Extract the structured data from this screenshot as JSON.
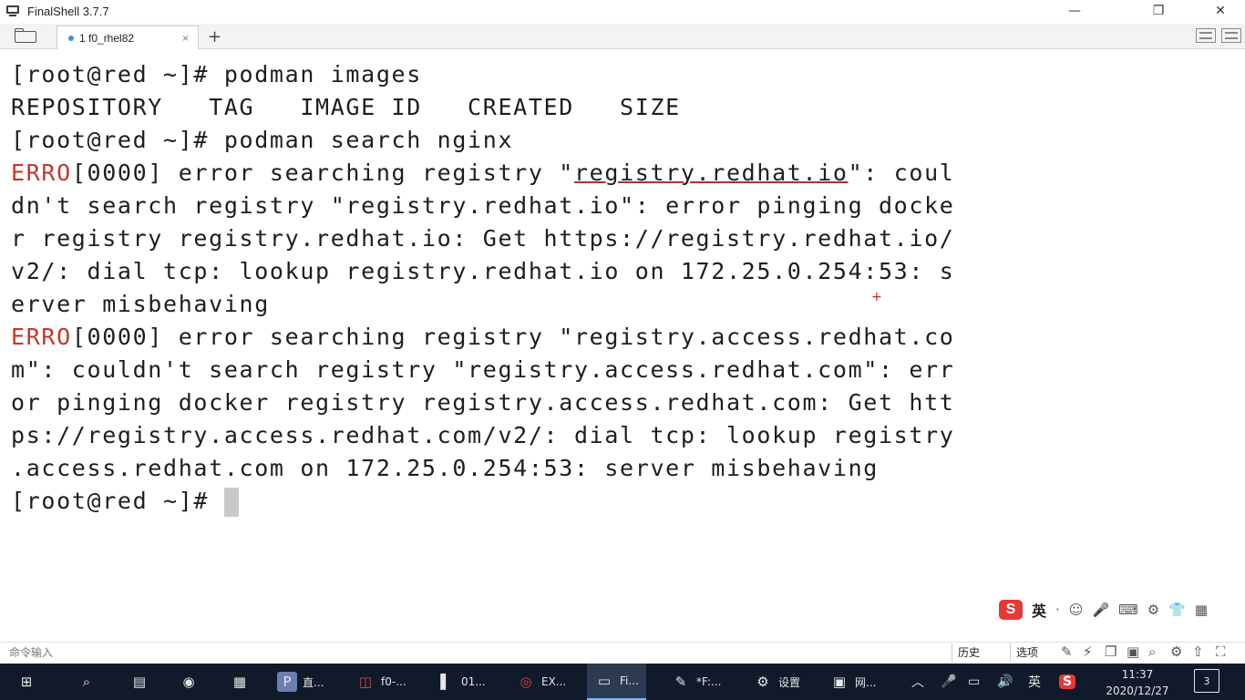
{
  "window": {
    "title": "FinalShell 3.7.7",
    "minimize": "—",
    "restore": "❐",
    "close": "✕"
  },
  "tabs": [
    {
      "label": "1 f0_rhel82",
      "close": "×"
    }
  ],
  "add_tab": "+",
  "terminal": {
    "l1": "[root@red ~]# podman images",
    "l2": "REPOSITORY   TAG   IMAGE ID   CREATED   SIZE",
    "l3": "[root@red ~]# podman search nginx",
    "erro": "ERRO",
    "l4_a": "[0000] error searching registry \"",
    "l4_u": "registry.redhat.io",
    "l4_b": "\": coul",
    "l5": "dn't search registry \"registry.redhat.io\": error pinging docke",
    "l6": "r registry registry.redhat.io: Get https://registry.redhat.io/",
    "l7": "v2/: dial tcp: lookup registry.redhat.io on 172.25.0.254:53: s",
    "l8": "erver misbehaving",
    "l9_b": "[0000] error searching registry \"registry.access.redhat.co",
    "l10": "m\": couldn't search registry \"registry.access.redhat.com\": err",
    "l11": "or pinging docker registry registry.access.redhat.com: Get htt",
    "l12": "ps://registry.access.redhat.com/v2/: dial tcp: lookup registry",
    "l13": ".access.redhat.com on 172.25.0.254:53: server misbehaving",
    "l14": "[root@red ~]# "
  },
  "ime": {
    "logo": "S",
    "lang": "英",
    "icons": [
      "·",
      "☺",
      "🎤",
      "⌨",
      "⚙",
      "👕",
      "▦"
    ]
  },
  "statusbar": {
    "input_placeholder": "命令输入",
    "history": "历史",
    "options": "选项"
  },
  "taskbar": {
    "items": [
      {
        "icon": "⊞",
        "label": ""
      },
      {
        "icon": "⌕",
        "label": ""
      },
      {
        "icon": "▤",
        "label": ""
      },
      {
        "icon": "◉",
        "label": ""
      },
      {
        "icon": "▦",
        "label": ""
      },
      {
        "icon": "P",
        "label": "直..."
      },
      {
        "icon": "◫",
        "label": "f0-..."
      },
      {
        "icon": "▌",
        "label": "01..."
      },
      {
        "icon": "◎",
        "label": "EX..."
      },
      {
        "icon": "▭",
        "label": "Fi..."
      },
      {
        "icon": "✎",
        "label": "*F:..."
      },
      {
        "icon": "⚙",
        "label": "设置"
      },
      {
        "icon": "▣",
        "label": "网..."
      }
    ],
    "tray_lang": "英",
    "time": "11:37",
    "date": "2020/12/27",
    "notif": "3"
  }
}
